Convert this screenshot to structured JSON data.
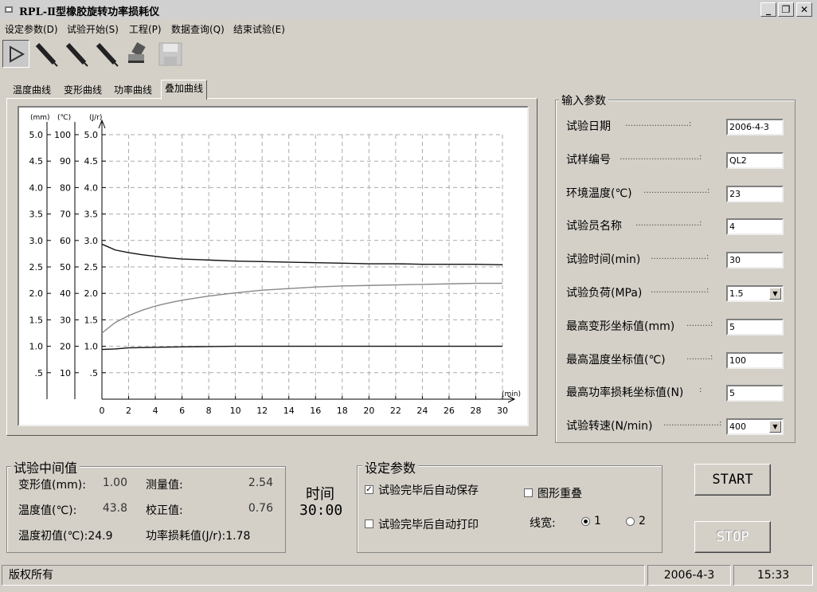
{
  "window": {
    "title": "RPL-Ⅱ型橡胶旋转功率损耗仪"
  },
  "menu": [
    "设定参数(D)",
    "试验开始(S)",
    "工程(P)",
    "数据查询(Q)",
    "结束试验(E)"
  ],
  "toolbar": {
    "icons": [
      "play-icon",
      "pen-icon",
      "pen-icon",
      "pen-icon",
      "stamp-icon",
      "save-icon"
    ]
  },
  "tabs": [
    "温度曲线",
    "变形曲线",
    "功率曲线",
    "叠加曲线"
  ],
  "chart_data": {
    "type": "line",
    "axis_units": [
      "(mm)",
      "(℃)",
      "(J/r)"
    ],
    "xlabel": "(min)",
    "x_ticks": [
      "0",
      "2",
      "4",
      "6",
      "8",
      "10",
      "12",
      "14",
      "16",
      "18",
      "20",
      "22",
      "24",
      "26",
      "28",
      "30"
    ],
    "xlim": [
      0,
      30
    ],
    "y_mm_ticks": [
      "5.0",
      "4.5",
      "4.0",
      "3.5",
      "3.0",
      "2.5",
      "2.0",
      "1.5",
      "1.0",
      ".5"
    ],
    "y_temp_ticks": [
      "100",
      "90",
      "80",
      "70",
      "60",
      "50",
      "40",
      "30",
      "20",
      "10"
    ],
    "y_power_ticks": [
      "5.0",
      "4.5",
      "4.0",
      "3.5",
      "3.0",
      "2.5",
      "2.0",
      "1.5",
      "1.0",
      ".5"
    ],
    "ylim": [
      0,
      5
    ],
    "grid": true,
    "series": [
      {
        "x": [
          0,
          1,
          2,
          3,
          4,
          5,
          6,
          8,
          10,
          12,
          14,
          16,
          18,
          20,
          22,
          24,
          26,
          28,
          30
        ],
        "values": [
          2.93,
          2.82,
          2.77,
          2.73,
          2.7,
          2.67,
          2.65,
          2.63,
          2.61,
          2.6,
          2.59,
          2.58,
          2.57,
          2.56,
          2.56,
          2.55,
          2.55,
          2.55,
          2.54
        ]
      },
      {
        "x": [
          0,
          1,
          2,
          3,
          4,
          5,
          6,
          8,
          10,
          12,
          14,
          16,
          18,
          20,
          22,
          24,
          26,
          28,
          30
        ],
        "values": [
          1.25,
          1.45,
          1.58,
          1.68,
          1.76,
          1.82,
          1.87,
          1.95,
          2.01,
          2.06,
          2.09,
          2.12,
          2.14,
          2.15,
          2.16,
          2.17,
          2.18,
          2.19,
          2.19
        ]
      },
      {
        "x": [
          0,
          1,
          2,
          4,
          6,
          10,
          14,
          18,
          22,
          26,
          30
        ],
        "values": [
          0.94,
          0.95,
          0.97,
          0.98,
          0.99,
          1.0,
          1.0,
          1.0,
          1.0,
          1.0,
          1.0
        ]
      }
    ]
  },
  "input_params": {
    "title": "输入参数",
    "rows": [
      {
        "label": "试验日期",
        "sep": "……………………:",
        "value": "2006-4-3"
      },
      {
        "label": "试样编号",
        "sep": "…………………………:",
        "value": "QL2"
      },
      {
        "label": "环境温度(℃)",
        "sep": "……………………:",
        "value": "23"
      },
      {
        "label": "试验员名称",
        "sep": "……………………:",
        "value": "4"
      },
      {
        "label": "试验时间(min)",
        "sep": "…………………:",
        "value": "30"
      },
      {
        "label": "试验负荷(MPa)",
        "sep": "…………………:",
        "value": "1.5"
      },
      {
        "label": "最高变形坐标值(mm)",
        "sep": "………:",
        "value": "5"
      },
      {
        "label": "最高温度坐标值(℃)",
        "sep": "………:",
        "value": "100"
      },
      {
        "label": "最高功率损耗坐标值(N)",
        "sep": ":",
        "value": "5"
      },
      {
        "label": "试验转速(N/min)",
        "sep": "…………………:",
        "value": "400"
      }
    ]
  },
  "mid_values": {
    "title": "试验中间值",
    "deform_label": "变形值(mm):",
    "deform_value": "1.00",
    "measure_label": "测量值:",
    "measure_value": "2.54",
    "temp_label": "温度值(℃):",
    "temp_value": "43.8",
    "correct_label": "校正值:",
    "correct_value": "0.76",
    "init_temp_label": "温度初值(℃):24.9",
    "power_label": "功率损耗值(J/r):1.78"
  },
  "time": {
    "label": "时间",
    "value": "30:00"
  },
  "settings": {
    "title": "设定参数",
    "auto_save": "试验完毕后自动保存",
    "auto_print": "试验完毕后自动打印",
    "overlay": "图形重叠",
    "linewidth_label": "线宽:",
    "lw1": "1",
    "lw2": "2"
  },
  "buttons": {
    "start": "START",
    "stop": "STOP"
  },
  "status": {
    "copyright": "版权所有",
    "date": "2006-4-3",
    "time": "15:33"
  }
}
